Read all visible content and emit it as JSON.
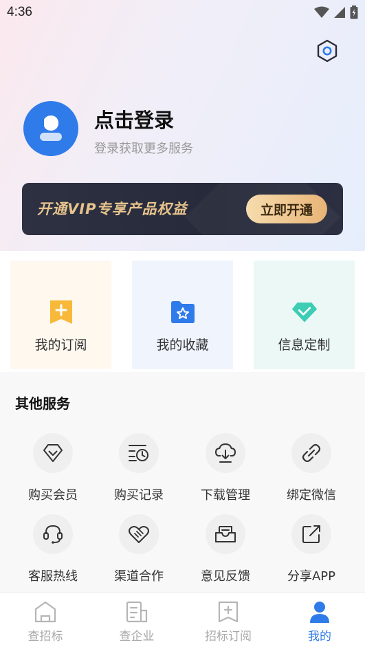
{
  "status_bar": {
    "time": "4:36"
  },
  "profile": {
    "title": "点击登录",
    "subtitle": "登录获取更多服务"
  },
  "vip": {
    "text": "开通VIP专享产品权益",
    "button": "立即开通"
  },
  "quick_actions": [
    {
      "label": "我的订阅",
      "icon": "bookmark-plus-icon"
    },
    {
      "label": "我的收藏",
      "icon": "star-folder-icon"
    },
    {
      "label": "信息定制",
      "icon": "check-diamond-icon"
    }
  ],
  "services": {
    "title": "其他服务",
    "items": [
      {
        "label": "购买会员",
        "icon": "diamond-icon"
      },
      {
        "label": "购买记录",
        "icon": "history-list-icon"
      },
      {
        "label": "下载管理",
        "icon": "cloud-download-icon"
      },
      {
        "label": "绑定微信",
        "icon": "link-icon"
      },
      {
        "label": "客服热线",
        "icon": "headset-icon"
      },
      {
        "label": "渠道合作",
        "icon": "handshake-heart-icon"
      },
      {
        "label": "意见反馈",
        "icon": "mailbox-icon"
      },
      {
        "label": "分享APP",
        "icon": "share-icon"
      }
    ]
  },
  "tabs": [
    {
      "label": "查招标",
      "icon": "home-icon"
    },
    {
      "label": "查企业",
      "icon": "company-icon"
    },
    {
      "label": "招标订阅",
      "icon": "subscribe-icon"
    },
    {
      "label": "我的",
      "icon": "user-icon",
      "active": true
    }
  ],
  "colors": {
    "accent": "#2f7bea",
    "vip_gold": "#e7c38c",
    "vip_bg": "#2a2e3e",
    "subscribe_orange": "#f8b83a",
    "custom_teal": "#3ccdb4"
  }
}
